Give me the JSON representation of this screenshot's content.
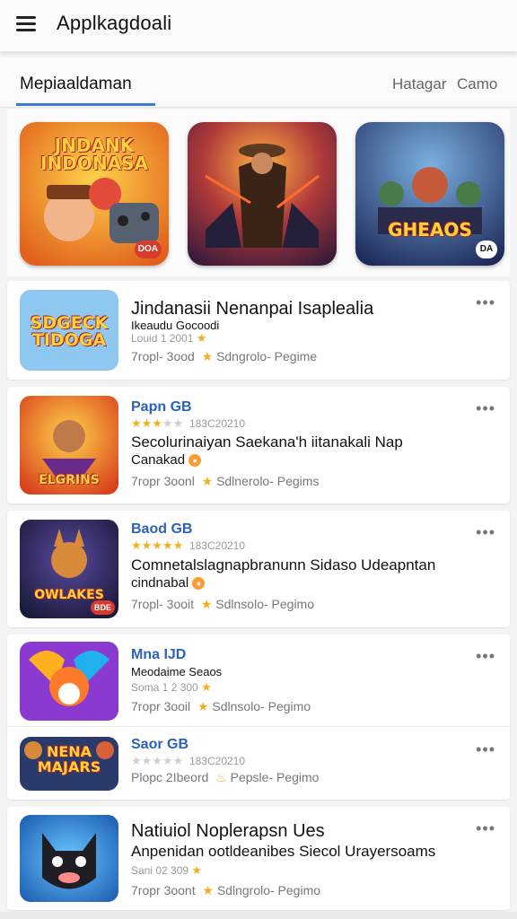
{
  "app": {
    "title": "Applkagdoali"
  },
  "tabs": {
    "active": "Mepiaaldaman",
    "right1": "Hatagar",
    "right2": "Camo"
  },
  "featured": [
    {
      "title": "JNDANK INDONASA",
      "badge": "DOA",
      "badge_color": "#d83a2e",
      "bg": "#f0a030"
    },
    {
      "title": "",
      "badge": "",
      "badge_color": "",
      "bg": "#8a2a3a"
    },
    {
      "title": "GHEAOS",
      "badge": "DA",
      "badge_color": "#ffffff",
      "bg": "#3a5a9a"
    }
  ],
  "list": [
    {
      "thumb_text": "SDGECK TIDOGA",
      "name": "Jindanasii Nenanpai Isaplealia",
      "sub": "Ikeaudu Gocoodi",
      "rating": "Louid 1 2001",
      "meta_left": "7ropl- 3ood",
      "meta_right": "Sdngrolo- Pegime"
    },
    {
      "thumb_text": "ELGRINS",
      "name": "Papn GB",
      "stars": 3,
      "rating": "183C20210",
      "desc1": "Secolurinaiyan Saekana'h iitanakali Nap",
      "desc2": "Canakad",
      "meta_left": "7ropr 3oonl",
      "meta_right": "Sdlnerolo- Pegims"
    },
    {
      "thumb_text": "OWLAKES",
      "thumb_badge": "BDE",
      "name": "Baod GB",
      "stars": 5,
      "rating": "183C20210",
      "desc1": "Comnetalslagnapbranunn Sidaso Udeapntan",
      "desc2": "cindnabal",
      "meta_left": "7ropl- 3ooit",
      "meta_right": "Sdlnsolo- Pegimo"
    },
    {
      "thumb_text": "",
      "name": "Mna IJD",
      "sub": "Meodaime Seaos",
      "rating": "Soma 1 2 300",
      "meta_left": "7ropr 3ooil",
      "meta_right": "Sdlnsolo- Pegimo"
    },
    {
      "thumb_text": "NENA MAJARS",
      "name": "Saor GB",
      "stars": 0,
      "rating": "183C20210",
      "meta_left": "Plopc 2Ibeord",
      "meta_right": "Pepsle- Pegimo"
    },
    {
      "thumb_text": "",
      "name": "Natiuiol Noplerapsn Ues",
      "desc1": "Anpenidan ootldeanibes Siecol Urayersoams",
      "rating": "Sani 02 309",
      "meta_left": "7ropr 3oont",
      "meta_right": "Sdlngrolo- Pegimo"
    }
  ]
}
